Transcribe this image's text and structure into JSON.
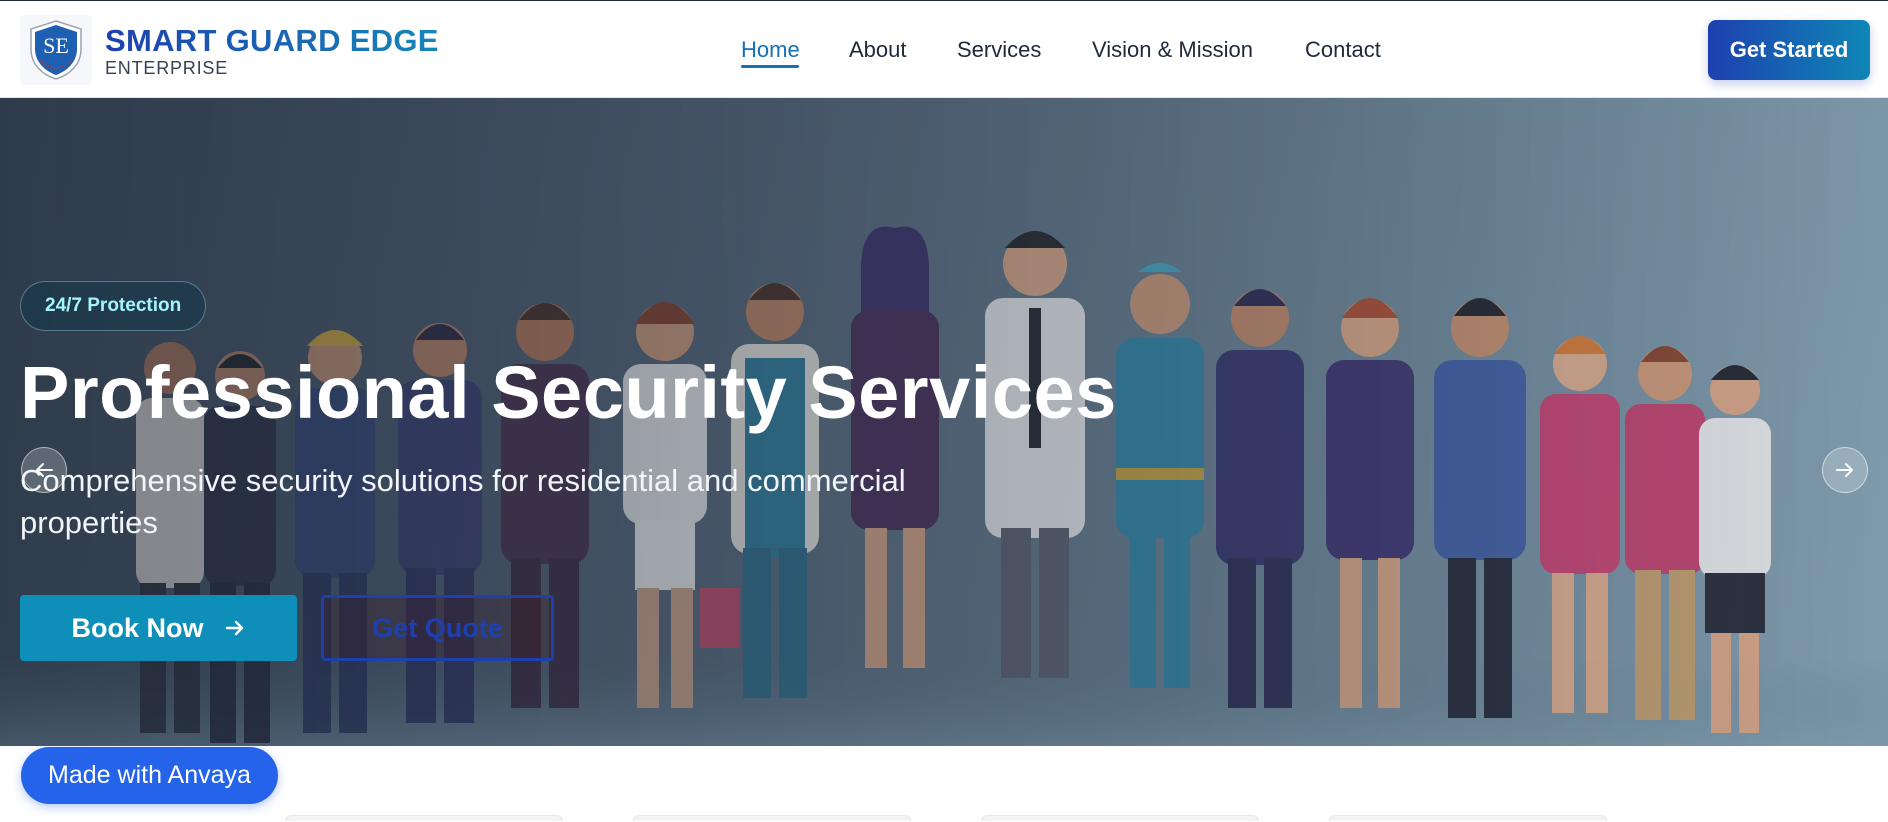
{
  "brand": {
    "title": "SMART GUARD EDGE",
    "subtitle": "ENTERPRISE",
    "logo_letters": "SE",
    "logo_icon": "shield-logo-icon"
  },
  "nav": {
    "items": [
      {
        "label": "Home",
        "active": true
      },
      {
        "label": "About",
        "active": false
      },
      {
        "label": "Services",
        "active": false
      },
      {
        "label": "Vision & Mission",
        "active": false
      },
      {
        "label": "Contact",
        "active": false
      }
    ],
    "cta_label": "Get Started"
  },
  "hero": {
    "badge": "24/7 Protection",
    "title": "Professional Security Services",
    "description": "Comprehensive security solutions for residential and commercial properties",
    "primary_button": "Book Now",
    "primary_button_icon": "arrow-right-icon",
    "secondary_button": "Get Quote",
    "prev_icon": "arrow-left-icon",
    "next_icon": "arrow-right-icon"
  },
  "footer_badge": "Made with Anvaya",
  "colors": {
    "brand_blue": "#1e40af",
    "accent_teal": "#0e8fb9",
    "nav_active": "#1570b8",
    "badge_text": "#a5f3fc",
    "made_with_bg": "#2563eb"
  }
}
